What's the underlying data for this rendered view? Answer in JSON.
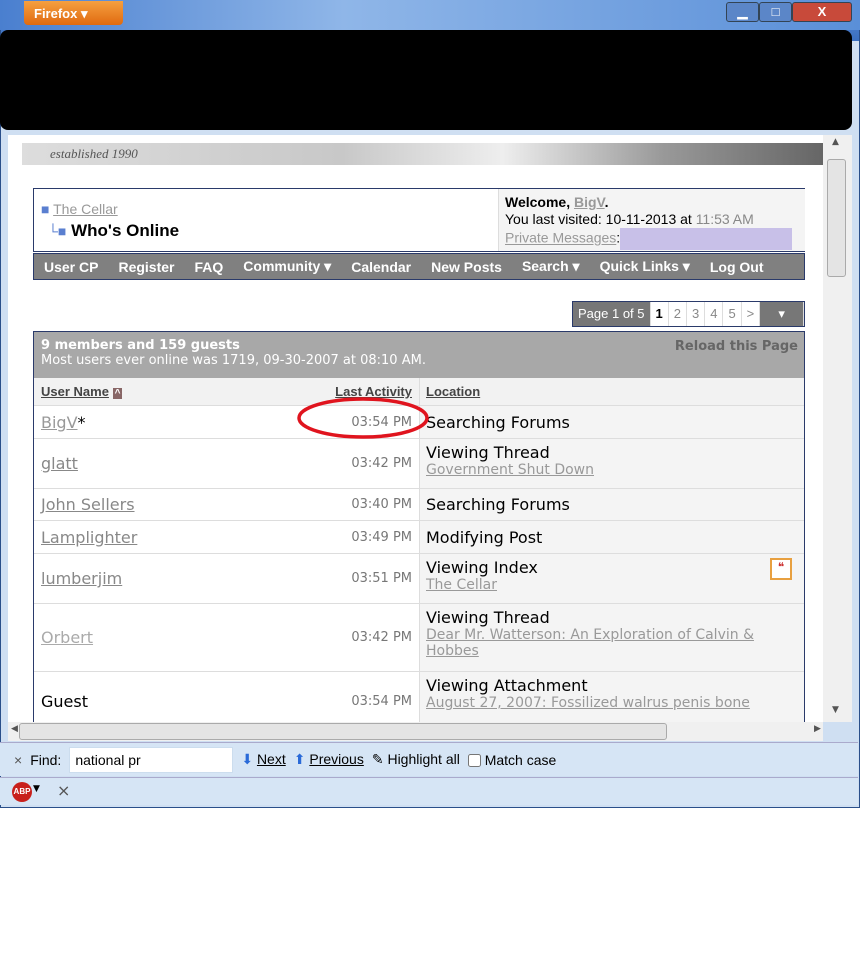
{
  "browser": {
    "menu_label": "Firefox",
    "minimize": "▁",
    "maximize": "□",
    "close": "X"
  },
  "banner": {
    "tagline": "established 1990"
  },
  "breadcrumb": {
    "parent": "The Cellar",
    "current": "Who's Online"
  },
  "welcome": {
    "prefix": "Welcome, ",
    "user": "BigV",
    "suffix": ".",
    "last_visited_label": "You last visited: ",
    "last_visited_date": "10-11-2013 at ",
    "last_visited_time": "11:53 AM",
    "pm_label": "Private Messages",
    ":": ":"
  },
  "nav": [
    "User CP",
    "Register",
    "FAQ",
    "Community ▾",
    "Calendar",
    "New Posts",
    "Search ▾",
    "Quick Links ▾",
    "Log Out"
  ],
  "pager": {
    "label": "Page 1 of 5",
    "pages": [
      "1",
      "2",
      "3",
      "4",
      "5"
    ],
    "next": ">",
    "menu": "▾",
    "current": "1"
  },
  "online": {
    "summary": "9 members and 159 guests",
    "record": "Most users ever online was 1719, 09-30-2007 at 08:10 AM.",
    "reload": "Reload this Page"
  },
  "columns": {
    "user": "User Name",
    "activity": "Last Activity",
    "location": "Location"
  },
  "rows": [
    {
      "user": "BigV",
      "suffix": "*",
      "time": "03:54 PM",
      "location": "Searching Forums",
      "sub": "",
      "user_color": "#999"
    },
    {
      "user": "glatt",
      "suffix": "",
      "time": "03:42 PM",
      "location": "Viewing Thread",
      "sub": "Government Shut Down",
      "user_color": "#888"
    },
    {
      "user": "John Sellers",
      "suffix": "",
      "time": "03:40 PM",
      "location": "Searching Forums",
      "sub": "",
      "user_color": "#888"
    },
    {
      "user": "Lamplighter",
      "suffix": "",
      "time": "03:49 PM",
      "location": "Modifying Post",
      "sub": "",
      "user_color": "#888"
    },
    {
      "user": "lumberjim",
      "suffix": "",
      "time": "03:51 PM",
      "location": "Viewing Index",
      "sub": "The Cellar",
      "user_color": "#888"
    },
    {
      "user": "Orbert",
      "suffix": "",
      "time": "03:42 PM",
      "location": "Viewing Thread",
      "sub": "Dear Mr. Watterson: An Exploration of Calvin & Hobbes",
      "user_color": "#aaa"
    },
    {
      "user": "Guest",
      "suffix": "",
      "time": "03:54 PM",
      "location": "Viewing Attachment",
      "sub": "August 27, 2007: Fossilized walrus penis bone",
      "user_color": "#000"
    }
  ],
  "annotation": {
    "color": "#e0141e"
  },
  "findbar": {
    "close": "×",
    "label": "Find:",
    "value": "national pr",
    "next": "Next",
    "previous": "Previous",
    "highlight": "Highlight all",
    "match_case": "Match case"
  },
  "addonbar": {
    "abp": "ABP",
    "close": "×"
  }
}
